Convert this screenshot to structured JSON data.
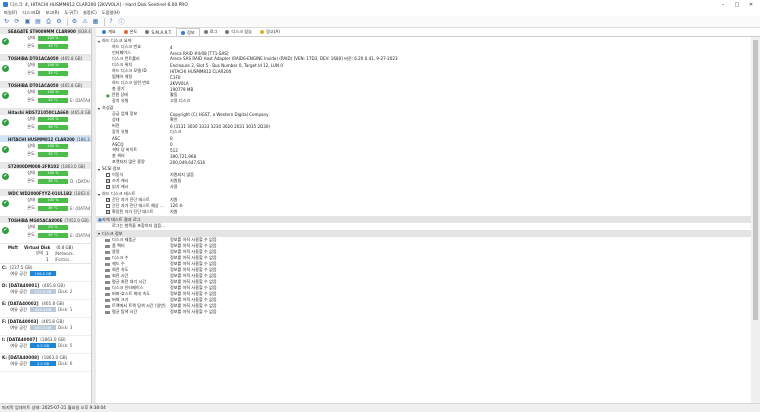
{
  "titlebar": {
    "title": "디스크: 4, HITACHI HUSMM812 CLAR200 [2KVV0LA] - Hard Disk Sentinel 6.00 PRO"
  },
  "menubar": {
    "items": [
      "파일(F)",
      "디스크(D)",
      "보고(R)",
      "도구(T)",
      "설정(C)",
      "도움말(H)"
    ]
  },
  "sidebar": {
    "disks": [
      {
        "name": "SEAGATE ST9009MM CLAR900",
        "size": "(838.4 ...",
        "health": "100 %",
        "temp": "33 °C",
        "extra": "",
        "selected": false
      },
      {
        "name": "TOSHIBA DT01ACA050",
        "size": "(465.8 GB)",
        "health": "100 %",
        "temp": "33 °C",
        "extra": "",
        "selected": false
      },
      {
        "name": "TOSHIBA DT01ACA050",
        "size": "(465.8 GB)",
        "health": "100 %",
        "temp": "33 °C",
        "extra": "E: (DATA40...",
        "selected": false
      },
      {
        "name": "Hitachi HDS721050CLA660",
        "size": "(465.8 GB)",
        "health": "100 %",
        "temp": "36 °C",
        "extra": "",
        "selected": false
      },
      {
        "name": "HITACHI HUSMM812 CLAR200",
        "size": "(186.3 ...",
        "health": "100 %",
        "temp": "33 °C",
        "extra": "",
        "selected": true
      },
      {
        "name": "ST2000DM008-2FR102",
        "size": "(1863.0 GB)",
        "health": "100 %",
        "temp": "36 °C",
        "extra": "D: (DATA40...",
        "selected": false
      },
      {
        "name": "WDC WD2000FYYZ-01UL1B2",
        "size": "(1863.0 GB)",
        "health": "100 %",
        "temp": "36 °C",
        "extra": "E: (DATA40...",
        "selected": false
      },
      {
        "name": "TOSHIBA MG05ACA800E",
        "size": "(7452.0 GB)",
        "health": "83 %",
        "temp": "39 °C",
        "extra": "E: (DATA40...",
        "selected": false
      }
    ],
    "raid": {
      "header_a": "Msft",
      "header_b": "Virtual Disk",
      "size": "(0.0 GB)",
      "rows": [
        {
          "label": "상태",
          "value": "1",
          "extra": "(Network..."
        },
        {
          "label": "",
          "value": "1",
          "extra": "(Fortiss..."
        }
      ]
    },
    "labels": {
      "health": "상태",
      "temp": "온도",
      "free": "여유 공간"
    },
    "volumes": [
      {
        "name": "C:",
        "size": "(237.5 GB)",
        "free": "156.0 GB",
        "extra": "",
        "low": false
      },
      {
        "name": "D: [DATA40001]",
        "size": "(465.8 GB)",
        "free": "125.3 GB",
        "extra": "Disk: 2",
        "low": true
      },
      {
        "name": "E: [DATA40002]",
        "size": "(465.8 GB)",
        "free": "424.4 GB",
        "extra": "Disk: 1",
        "low": true
      },
      {
        "name": "F: [DATA40003]",
        "size": "(465.8 GB)",
        "free": "450.4 GB",
        "extra": "Disk: 3",
        "low": true
      },
      {
        "name": "I: [DATA40007]",
        "size": "(1863.0 GB)",
        "free": "0.0 GB",
        "extra": "Disk: 5",
        "low": false
      },
      {
        "name": "K: [DATA40008]",
        "size": "(1863.0 GB)",
        "free": "2.0 GB",
        "extra": "Disk: 6",
        "low": false
      }
    ]
  },
  "tabs": [
    {
      "label": "개요",
      "color": "#3b7bd1"
    },
    {
      "label": "온도",
      "color": "#e06c2b"
    },
    {
      "label": "S.M.A.R.T.",
      "color": "#777777"
    },
    {
      "label": "정보",
      "color": "#3b7bd1"
    },
    {
      "label": "로그",
      "color": "#777777"
    },
    {
      "label": "디스크 성능",
      "color": "#777777"
    },
    {
      "label": "경고(A)",
      "color": "#e0b12b"
    }
  ],
  "content": {
    "sec_disk": {
      "title": "하드 디스크 요약",
      "rows": [
        [
          "하드 디스크 번호",
          "4"
        ],
        [
          "인터페이스",
          "Areca RAID #4/08 [T71-SAS]"
        ],
        [
          "디스크 컨트롤러",
          "Areca SAS RAID Host Adapter (RAID6-ENGINE Inside) (RAID) [VEN: 17D3, DEV: 1680] 버전: 6.20.0.41, 9-27-2023"
        ],
        [
          "디스크 위치",
          "Enclosure 2, Slot 5 - Bus Number 0, Target Id 12, LUN 0"
        ],
        [
          "하드 디스크 모델 ID",
          "HITACHI HUSMM812 CLAR200"
        ],
        [
          "펌웨어 개정",
          "C1F0"
        ],
        [
          "하드 디스크 일련 번호",
          "2KVV0LA"
        ],
        [
          "총 용기",
          "190779 MB"
        ],
        [
          "전원 상태",
          "활동"
        ],
        [
          "장치 유형",
          "고정 디스크"
        ]
      ]
    },
    "sec_standard": {
      "title": "속성값",
      "rows": [
        [
          "공급 업체 정보",
          "Copyright (C) HGST, a Western Digital Company"
        ],
        [
          "상태",
          "확인"
        ],
        [
          "버전",
          "6 (3131 3030 3333 3230 3620 2031 3035 2D30)"
        ],
        [
          "장치 유형",
          "디스크"
        ],
        [
          "ASC",
          "0"
        ],
        [
          "ASCQ",
          "0"
        ],
        [
          "섹터 당 바이트",
          "512"
        ],
        [
          "총 섹터",
          "390,721,968"
        ],
        [
          "포맷되지 않은 용량",
          "200,049,647,616"
        ]
      ]
    },
    "sec_scsi": {
      "title": "SCSI 정보",
      "rows": [
        [
          "이동식",
          "지원되지 않음"
        ],
        [
          "쓰기 캐시",
          "지원됨"
        ],
        [
          "읽기 캐시",
          "사용"
        ]
      ]
    },
    "sec_selftest": {
      "title": "하드 디스크 테스트",
      "rows": [
        [
          "간단 자가 진단 테스트",
          "지원"
        ],
        [
          "간단 자가 진단 테스트 예상 ...",
          "126 초"
        ],
        [
          "확장된 자가 진단 테스트",
          "지원"
        ]
      ]
    },
    "sec_log": {
      "title": "자체 테스트 결과 로그",
      "note": "로그는 항목을 포함하지 않음..."
    },
    "sec_features": {
      "title": "디스크 정보",
      "rows": [
        [
          "디스크 제품군",
          "정보를 아직 사용할 수 없음"
        ],
        [
          "폼 팩터",
          "정보를 아직 사용할 수 없음"
        ],
        [
          "용량",
          "정보를 아직 사용할 수 없음"
        ],
        [
          "디스크 수",
          "정보를 아직 사용할 수 없음"
        ],
        [
          "헤드 수",
          "정보를 아직 사용할 수 없음"
        ],
        [
          "회전 속도",
          "정보를 아직 사용할 수 없음"
        ],
        [
          "회전 시간",
          "정보를 아직 사용할 수 없음"
        ],
        [
          "평균 회전 대기 시간",
          "정보를 아직 사용할 수 없음"
        ],
        [
          "디스크 인터페이스",
          "정보를 아직 사용할 수 없음"
        ],
        [
          "버퍼-호스트 최대 속도",
          "정보를 아직 사용할 수 없음"
        ],
        [
          "버퍼 크기",
          "정보를 아직 사용할 수 없음"
        ],
        [
          "트랙에서 트랙 탐색 시간 (일반)",
          "정보를 아직 사용할 수 없음"
        ],
        [
          "평균 탐색 시간",
          "정보를 아직 사용할 수 없음"
        ]
      ]
    }
  },
  "statusbar": {
    "text": "마지막 업데이트 상태: 2025-07-21 월요일 오후 9:38:04"
  }
}
